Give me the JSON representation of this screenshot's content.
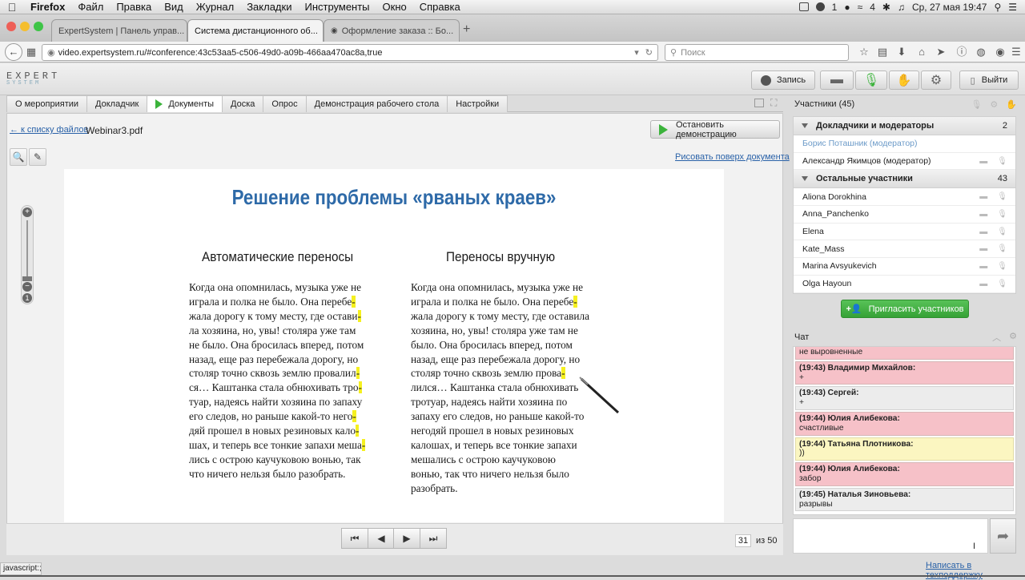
{
  "menubar": {
    "app": "Firefox",
    "items": [
      "Файл",
      "Правка",
      "Вид",
      "Журнал",
      "Закладки",
      "Инструменты",
      "Окно",
      "Справка"
    ],
    "battery_number": "1",
    "badge": "4",
    "clock": "Ср, 27 мая  19:47"
  },
  "browser": {
    "tabs": [
      {
        "title": "ExpertSystem | Панель управ..."
      },
      {
        "title": "Система дистанционного об..."
      },
      {
        "title": "Оформление заказа :: Бо..."
      }
    ],
    "new_tab": "+",
    "url": "video.expertsystem.ru/#conference:43c53aa5-c506-49d0-a09b-466aa470ac8a,true",
    "search_placeholder": "Поиск"
  },
  "app": {
    "logo": "EXPERT",
    "logo_sub": "SYSTEM",
    "record_label": "Запись",
    "exit_label": "Выйти"
  },
  "tabs": [
    "О мероприятии",
    "Докладчик",
    "Документы",
    "Доска",
    "Опрос",
    "Демонстрация рабочего стола",
    "Настройки"
  ],
  "active_tab": "Документы",
  "docs": {
    "back_link": "← к списку файлов",
    "filename": "Webinar3.pdf",
    "stop_label": "Остановить демонстрацию",
    "draw_link": "Рисовать поверх документа"
  },
  "slide": {
    "title": "Решение проблемы «рваных краев»",
    "left_title": "Автоматические переносы",
    "right_title": "Переносы вручную",
    "left_lines": [
      {
        "t": "Когда она опомнилась, музыка уже не",
        "h": ""
      },
      {
        "t": "играла и полка не было. Она перебе",
        "h": "-"
      },
      {
        "t": "жала дорогу к тому месту, где остави",
        "h": "-"
      },
      {
        "t": "ла хозяина, но, увы! столяра уже там",
        "h": ""
      },
      {
        "t": "не было. Она бросилась вперед, потом",
        "h": ""
      },
      {
        "t": "назад, еще раз перебежала дорогу, но",
        "h": ""
      },
      {
        "t": "столяр точно сквозь землю провалил",
        "h": "-"
      },
      {
        "t": "ся… Каштанка стала обнюхивать тро",
        "h": "-"
      },
      {
        "t": "туар, надеясь найти хозяина по запаху",
        "h": ""
      },
      {
        "t": "его следов, но раньше какой-то него",
        "h": "-"
      },
      {
        "t": "дяй прошел в новых резиновых кало",
        "h": "-"
      },
      {
        "t": "шах, и теперь все тонкие запахи меша",
        "h": "-"
      },
      {
        "t": "лись с острою каучуковою вонью, так",
        "h": ""
      },
      {
        "t": "что ничего нельзя было разобрать.",
        "h": ""
      }
    ],
    "right_lines": [
      {
        "t": "Когда она опомнилась, музыка уже не",
        "h": ""
      },
      {
        "t": "играла и полка не было. Она перебе",
        "h": "-"
      },
      {
        "t": "жала дорогу к тому месту, где оставила",
        "h": ""
      },
      {
        "t": "хозяина, но, увы! столяра уже там не",
        "h": ""
      },
      {
        "t": "было. Она бросилась вперед, потом",
        "h": ""
      },
      {
        "t": "назад, еще раз перебежала дорогу, но",
        "h": ""
      },
      {
        "t": "столяр точно сквозь землю прова",
        "h": "-"
      },
      {
        "t": "лился… Каштанка стала обнюхивать",
        "h": ""
      },
      {
        "t": "тротуар, надеясь найти хозяина по",
        "h": ""
      },
      {
        "t": "запаху его следов, но раньше какой-то",
        "h": ""
      },
      {
        "t": "негодяй прошел в новых резиновых",
        "h": ""
      },
      {
        "t": "калошах, и теперь все тонкие запахи",
        "h": ""
      },
      {
        "t": "мешались с острою каучуковою",
        "h": ""
      },
      {
        "t": "вонью, так что ничего нельзя было",
        "h": ""
      },
      {
        "t": "разобрать.",
        "h": ""
      }
    ]
  },
  "pager": {
    "current": "31",
    "total": "из 50"
  },
  "participants": {
    "header": "Участники (45)",
    "groups": [
      {
        "name": "Докладчики и модераторы",
        "count": "2",
        "members": [
          {
            "name": "Борис Поташник (модератор)",
            "mod": true
          },
          {
            "name": "Александр Якимцов (модератор)",
            "mod": false
          }
        ]
      },
      {
        "name": "Остальные участники",
        "count": "43",
        "members": [
          {
            "name": "Aliona Dorokhina"
          },
          {
            "name": "Anna_Panchenko"
          },
          {
            "name": "Elena"
          },
          {
            "name": "Kate_Mass"
          },
          {
            "name": "Marina Avsyukevich"
          },
          {
            "name": "Olga Hayoun"
          }
        ]
      }
    ],
    "invite_label": "Пригласить участников"
  },
  "chat": {
    "header": "Чат",
    "messages": [
      {
        "author": "",
        "text": "не выровненные",
        "color": "pink"
      },
      {
        "author": "(19:43) Владимир Михайлов:",
        "text": "+",
        "color": "pink"
      },
      {
        "author": "(19:43) Сергей:",
        "text": "+",
        "color": "gray"
      },
      {
        "author": "(19:44) Юлия Алибекова:",
        "text": "счастливые",
        "color": "pink"
      },
      {
        "author": "(19:44) Татьяна Плотникова:",
        "text": "))",
        "color": "yellow"
      },
      {
        "author": "(19:44) Юлия Алибекова:",
        "text": "забор",
        "color": "pink"
      },
      {
        "author": "(19:45) Наталья Зиновьева:",
        "text": "разрывы",
        "color": "gray"
      }
    ],
    "support_link": "Написать в техподдержку"
  },
  "statusbar": "javascript:;",
  "colors": {
    "accent_green": "#3bb33b",
    "link_blue": "#2a62a8",
    "title_blue": "#2e6aa8",
    "highlight": "#f5f020"
  }
}
